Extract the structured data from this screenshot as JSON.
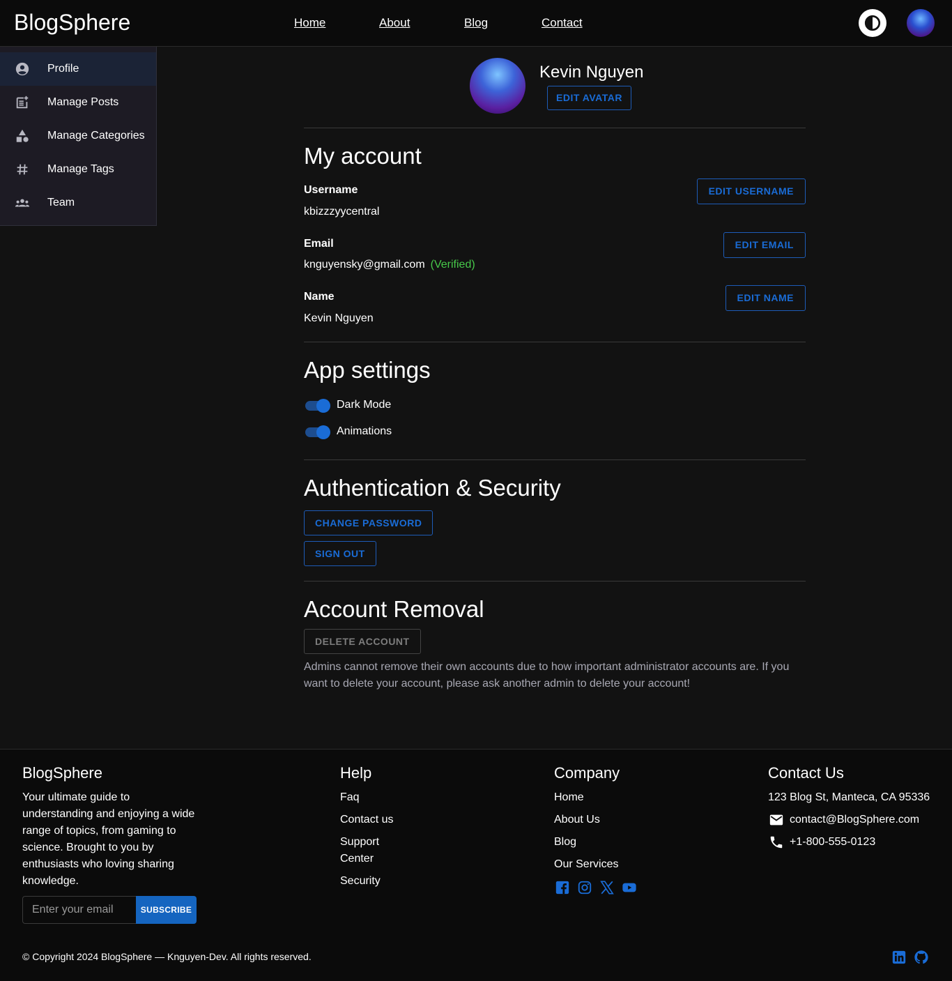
{
  "header": {
    "logo": "BlogSphere",
    "nav": [
      "Home",
      "About",
      "Blog",
      "Contact"
    ]
  },
  "sidebar": {
    "items": [
      {
        "label": "Profile",
        "icon": "account-circle-icon",
        "active": true
      },
      {
        "label": "Manage Posts",
        "icon": "post-add-icon",
        "active": false
      },
      {
        "label": "Manage Categories",
        "icon": "category-icon",
        "active": false
      },
      {
        "label": "Manage Tags",
        "icon": "tag-icon",
        "active": false
      },
      {
        "label": "Team",
        "icon": "group-icon",
        "active": false
      }
    ]
  },
  "profile": {
    "name": "Kevin Nguyen",
    "edit_avatar": "EDIT AVATAR"
  },
  "account": {
    "title": "My account",
    "username_label": "Username",
    "username_value": "kbizzzyycentral",
    "edit_username": "EDIT USERNAME",
    "email_label": "Email",
    "email_value": "knguyensky@gmail.com",
    "email_status": "(Verified)",
    "edit_email": "EDIT EMAIL",
    "name_label": "Name",
    "name_value": "Kevin Nguyen",
    "edit_name": "EDIT NAME"
  },
  "app_settings": {
    "title": "App settings",
    "dark_mode": {
      "label": "Dark Mode",
      "enabled": true
    },
    "animations": {
      "label": "Animations",
      "enabled": true
    }
  },
  "security": {
    "title": "Authentication & Security",
    "change_password": "CHANGE PASSWORD",
    "sign_out": "SIGN OUT"
  },
  "removal": {
    "title": "Account Removal",
    "delete_account": "DELETE ACCOUNT",
    "note": "Admins cannot remove their own accounts due to how important administrator accounts are. If you want to delete your account, please ask another admin to delete your account!"
  },
  "footer": {
    "brand": {
      "title": "BlogSphere",
      "description": "Your ultimate guide to understanding and enjoying a wide range of topics, from gaming to science. Brought to you by enthusiasts who loving sharing knowledge.",
      "email_placeholder": "Enter your email",
      "subscribe": "SUBSCRIBE"
    },
    "help": {
      "title": "Help",
      "links": [
        "Faq",
        "Contact us",
        "Support Center",
        "Security"
      ]
    },
    "company": {
      "title": "Company",
      "links": [
        "Home",
        "About Us",
        "Blog",
        "Our Services"
      ]
    },
    "contact": {
      "title": "Contact Us",
      "address": "123 Blog St, Manteca, CA 95336",
      "email": "contact@BlogSphere.com",
      "phone": "+1-800-555-0123"
    },
    "copyright": "© Copyright 2024 BlogSphere — Knguyen-Dev. All rights reserved.",
    "social_icons": [
      "facebook-icon",
      "instagram-icon",
      "x-icon",
      "youtube-icon"
    ],
    "bottom_icons": [
      "linkedin-icon",
      "github-icon"
    ]
  },
  "colors": {
    "accent": "#1a6cd6",
    "verified": "#47c94a",
    "background": "#121212"
  }
}
